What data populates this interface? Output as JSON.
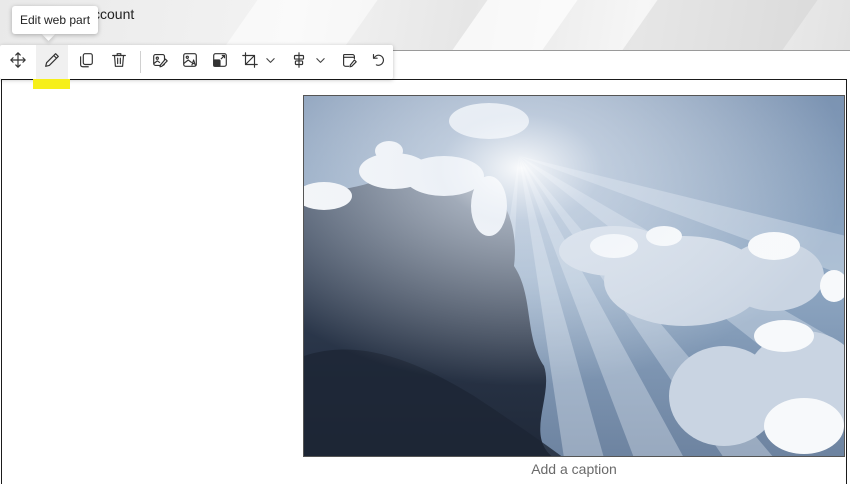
{
  "header": {
    "title_fragment": "ccount"
  },
  "toolbar": {
    "tooltip": "Edit web part",
    "buttons": [
      {
        "name": "move",
        "icon": "move-icon"
      },
      {
        "name": "edit",
        "icon": "pencil-icon"
      },
      {
        "name": "duplicate",
        "icon": "copy-icon"
      },
      {
        "name": "delete",
        "icon": "trash-icon"
      },
      {
        "name": "edit-image",
        "icon": "image-edit-icon"
      },
      {
        "name": "alt-text",
        "icon": "image-alt-text-icon"
      },
      {
        "name": "resize",
        "icon": "image-resize-icon"
      },
      {
        "name": "crop",
        "icon": "crop-icon"
      },
      {
        "name": "align",
        "icon": "align-icon"
      },
      {
        "name": "edit-properties",
        "icon": "properties-edit-icon"
      },
      {
        "name": "reset",
        "icon": "undo-icon"
      }
    ]
  },
  "image": {
    "description_icon": "sky-clouds-photo"
  },
  "caption": {
    "placeholder": "Add a caption"
  },
  "colors": {
    "highlight": "#f6ef1a",
    "section_border": "#1b1b1b"
  }
}
